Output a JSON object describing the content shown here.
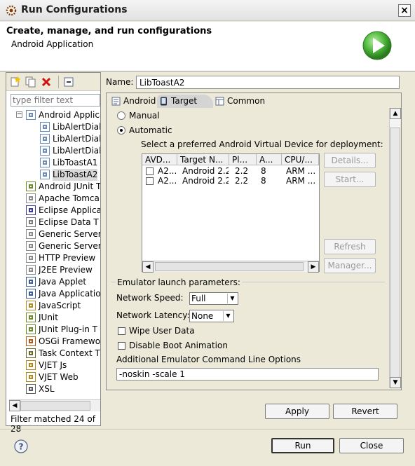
{
  "window": {
    "title": "Run Configurations"
  },
  "header": {
    "title": "Create, manage, and run configurations",
    "subtitle": "Android Application"
  },
  "left": {
    "filter_placeholder": "type filter text",
    "tree": [
      {
        "label": "Android Applica",
        "icon": "android-app-icon",
        "level": 0,
        "expanded": true
      },
      {
        "label": "LibAlertDialo",
        "icon": "launch-config-icon",
        "level": 1
      },
      {
        "label": "LibAlertDialo",
        "icon": "launch-config-icon",
        "level": 1
      },
      {
        "label": "LibAlertDialo",
        "icon": "launch-config-icon",
        "level": 1
      },
      {
        "label": "LibToastA1",
        "icon": "launch-config-icon",
        "level": 1
      },
      {
        "label": "LibToastA2",
        "icon": "launch-config-icon",
        "level": 1,
        "selected": true
      },
      {
        "label": "Android JUnit T",
        "icon": "junit-icon",
        "level": 0
      },
      {
        "label": "Apache Tomca",
        "icon": "server-icon",
        "level": 0
      },
      {
        "label": "Eclipse Applica",
        "icon": "eclipse-icon",
        "level": 0
      },
      {
        "label": "Eclipse Data T",
        "icon": "database-icon",
        "level": 0
      },
      {
        "label": "Generic Server",
        "icon": "server-icon",
        "level": 0
      },
      {
        "label": "Generic Server",
        "icon": "server-icon",
        "level": 0
      },
      {
        "label": "HTTP Preview",
        "icon": "server-icon",
        "level": 0
      },
      {
        "label": "J2EE Preview",
        "icon": "server-icon",
        "level": 0
      },
      {
        "label": "Java Applet",
        "icon": "applet-icon",
        "level": 0
      },
      {
        "label": "Java Applicatio",
        "icon": "java-app-icon",
        "level": 0
      },
      {
        "label": "JavaScript",
        "icon": "javascript-icon",
        "level": 0
      },
      {
        "label": "JUnit",
        "icon": "junit-icon",
        "level": 0
      },
      {
        "label": "JUnit Plug-in T",
        "icon": "junit-plugin-icon",
        "level": 0
      },
      {
        "label": "OSGi Framewo",
        "icon": "osgi-icon",
        "level": 0
      },
      {
        "label": "Task Context T",
        "icon": "task-context-icon",
        "level": 0
      },
      {
        "label": "VJET Js",
        "icon": "vjet-icon",
        "level": 0
      },
      {
        "label": "VJET Web",
        "icon": "vjet-icon",
        "level": 0
      },
      {
        "label": "XSL",
        "icon": "xsl-icon",
        "level": 0
      }
    ],
    "filter_status": "Filter matched 24 of 28"
  },
  "name": {
    "label": "Name:",
    "value": "LibToastA2"
  },
  "tabs": [
    {
      "label": "Android",
      "icon": "android-tab-icon"
    },
    {
      "label": "Target",
      "icon": "target-tab-icon",
      "active": true
    },
    {
      "label": "Common",
      "icon": "common-tab-icon"
    }
  ],
  "target": {
    "manual_label": "Manual",
    "automatic_label": "Automatic",
    "selected_mode": "Automatic",
    "prompt": "Select a preferred Android Virtual Device for deployment:",
    "columns": [
      "AVD...",
      "Target N...",
      "Pl...",
      "A...",
      "CPU/..."
    ],
    "rows": [
      [
        "A2...",
        "Android 2.2",
        "2.2",
        "8",
        "ARM ..."
      ],
      [
        "A2...",
        "Android 2.2",
        "2.2",
        "8",
        "ARM ..."
      ]
    ],
    "buttons": {
      "details": "Details...",
      "start": "Start...",
      "refresh": "Refresh",
      "manager": "Manager..."
    }
  },
  "emulator": {
    "group_title": "Emulator launch parameters:",
    "speed_label": "Network Speed:",
    "speed_value": "Full",
    "latency_label": "Network Latency:",
    "latency_value": "None",
    "wipe_label": "Wipe User Data",
    "wipe_checked": false,
    "boot_anim_label": "Disable Boot Animation",
    "boot_anim_checked": false,
    "cmd_label": "Additional Emulator Command Line Options",
    "cmd_value": "-noskin -scale 1"
  },
  "actions": {
    "apply": "Apply",
    "revert": "Revert",
    "run": "Run",
    "close": "Close"
  }
}
